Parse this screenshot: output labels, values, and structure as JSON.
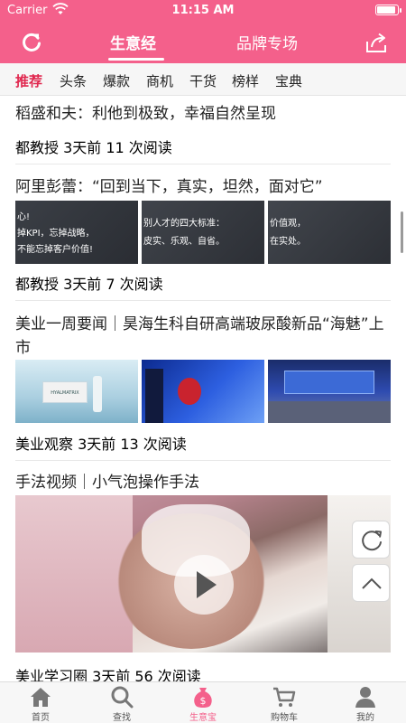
{
  "status": {
    "carrier": "Carrier",
    "time": "11:15 AM",
    "battery_level": 0.9
  },
  "header": {
    "tabs": [
      {
        "label": "生意经",
        "active": true
      },
      {
        "label": "品牌专场",
        "active": false
      }
    ]
  },
  "categories": [
    {
      "label": "推荐",
      "active": true
    },
    {
      "label": "头条"
    },
    {
      "label": "爆款"
    },
    {
      "label": "商机"
    },
    {
      "label": "干货"
    },
    {
      "label": "榜样"
    },
    {
      "label": "宝典"
    }
  ],
  "articles": [
    {
      "title": "稻盛和夫：利他到极致，幸福自然呈现",
      "meta": "都教授  3天前  11 次阅读"
    },
    {
      "title": "阿里彭蕾：“回到当下，真实，坦然，面对它”",
      "meta": "都教授  3天前  7 次阅读",
      "thumb_texts": [
        [
          "心!",
          "掉KPI，忘掉战略，",
          "不能忘掉客户价值!"
        ],
        [
          "别人才的四大标准：",
          "皮实、乐观、自省。"
        ],
        [
          "价值观，",
          "在实处。"
        ]
      ]
    },
    {
      "title": "美业一周要闻｜昊海生科自研高端玻尿酸新品“海魅”上市",
      "meta": "美业观察  3天前  13 次阅读",
      "thumb_texts": [
        [
          "HYALMATRIX"
        ]
      ]
    },
    {
      "title": "手法视频｜小气泡操作手法",
      "meta": "美业学习圈  3天前  56 次阅读"
    }
  ],
  "tabbar": [
    {
      "label": "首页",
      "icon": "home-icon"
    },
    {
      "label": "查找",
      "icon": "search-icon"
    },
    {
      "label": "生意宝",
      "icon": "money-bag-icon",
      "active": true
    },
    {
      "label": "购物车",
      "icon": "cart-icon"
    },
    {
      "label": "我的",
      "icon": "user-icon"
    }
  ],
  "colors": {
    "brand": "#f4608b",
    "accent_red": "#e0284f"
  }
}
